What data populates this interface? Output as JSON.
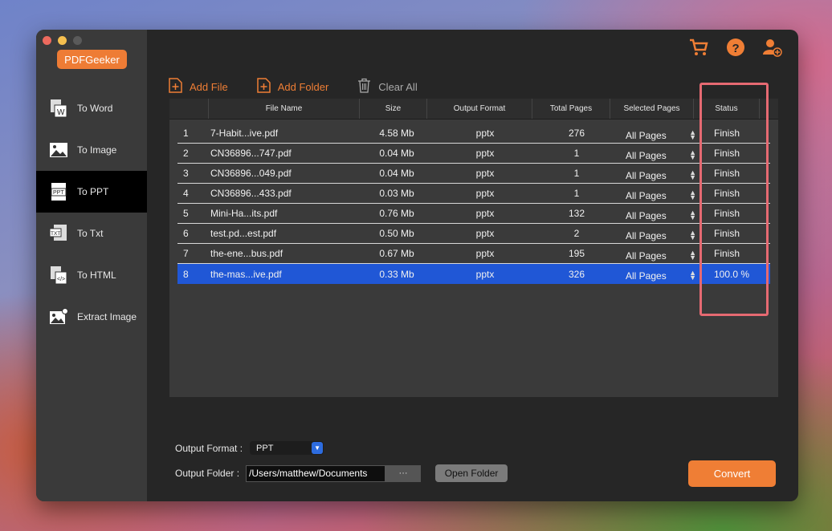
{
  "app": {
    "brand": "PDFGeeker"
  },
  "sidebar": {
    "items": [
      {
        "label": "To Word",
        "icon": "word-doc-icon"
      },
      {
        "label": "To Image",
        "icon": "image-icon"
      },
      {
        "label": "To PPT",
        "icon": "ppt-doc-icon"
      },
      {
        "label": "To Txt",
        "icon": "txt-doc-icon"
      },
      {
        "label": "To HTML",
        "icon": "html-doc-icon"
      },
      {
        "label": "Extract Image",
        "icon": "extract-image-icon"
      }
    ],
    "active": "To PPT"
  },
  "toolbar": {
    "add_file": "Add File",
    "add_folder": "Add Folder",
    "clear_all": "Clear All"
  },
  "table": {
    "columns": [
      "File Name",
      "Size",
      "Output Format",
      "Total Pages",
      "Selected Pages",
      "Status"
    ],
    "rows": [
      {
        "num": "1",
        "name": "7-Habit...ive.pdf",
        "size": "4.58 Mb",
        "format": "pptx",
        "pages": "276",
        "selected": "All Pages",
        "status": "Finish"
      },
      {
        "num": "2",
        "name": "CN36896...747.pdf",
        "size": "0.04 Mb",
        "format": "pptx",
        "pages": "1",
        "selected": "All Pages",
        "status": "Finish"
      },
      {
        "num": "3",
        "name": "CN36896...049.pdf",
        "size": "0.04 Mb",
        "format": "pptx",
        "pages": "1",
        "selected": "All Pages",
        "status": "Finish"
      },
      {
        "num": "4",
        "name": "CN36896...433.pdf",
        "size": "0.03 Mb",
        "format": "pptx",
        "pages": "1",
        "selected": "All Pages",
        "status": "Finish"
      },
      {
        "num": "5",
        "name": "Mini-Ha...its.pdf",
        "size": "0.76 Mb",
        "format": "pptx",
        "pages": "132",
        "selected": "All Pages",
        "status": "Finish"
      },
      {
        "num": "6",
        "name": "test.pd...est.pdf",
        "size": "0.50 Mb",
        "format": "pptx",
        "pages": "2",
        "selected": "All Pages",
        "status": "Finish"
      },
      {
        "num": "7",
        "name": "the-ene...bus.pdf",
        "size": "0.67 Mb",
        "format": "pptx",
        "pages": "195",
        "selected": "All Pages",
        "status": "Finish"
      },
      {
        "num": "8",
        "name": "the-mas...ive.pdf",
        "size": "0.33 Mb",
        "format": "pptx",
        "pages": "326",
        "selected": "All Pages",
        "status": "100.0 %"
      }
    ],
    "selected_row": "8"
  },
  "output": {
    "format_label": "Output Format :",
    "format_value": "PPT",
    "folder_label": "Output Folder :",
    "folder_value": "/Users/matthew/Documents",
    "browse_label": "···",
    "open_folder": "Open Folder"
  },
  "convert_label": "Convert",
  "colors": {
    "accent": "#ef7e35",
    "selection": "#2057d6",
    "highlight": "#e66a72"
  }
}
